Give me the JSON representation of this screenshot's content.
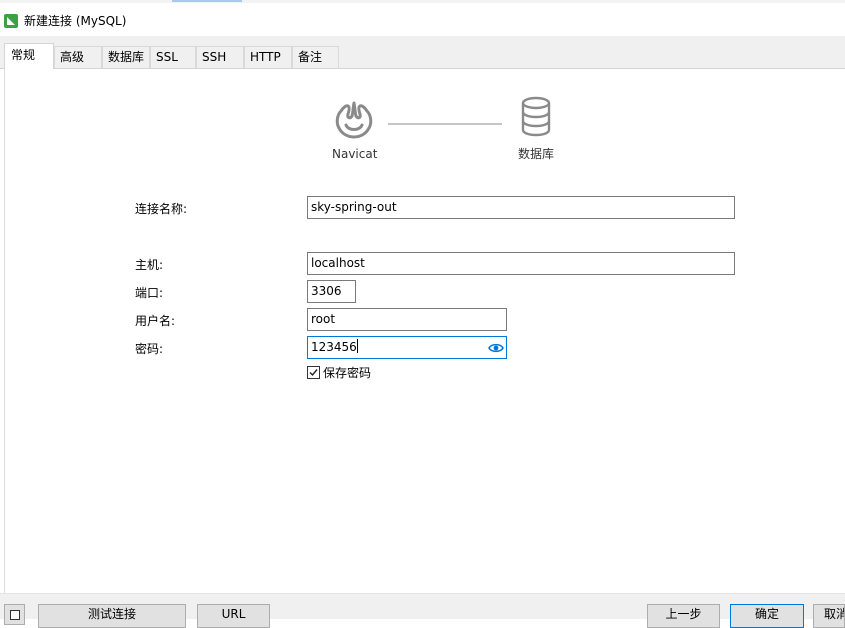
{
  "window": {
    "title": "新建连接 (MySQL)"
  },
  "tabs": [
    {
      "label": "常规",
      "active": true
    },
    {
      "label": "高级"
    },
    {
      "label": "数据库"
    },
    {
      "label": "SSL"
    },
    {
      "label": "SSH"
    },
    {
      "label": "HTTP"
    },
    {
      "label": "备注"
    }
  ],
  "diagram": {
    "left_caption": "Navicat",
    "right_caption": "数据库",
    "left_icon": "navicat-logo-icon",
    "right_icon": "database-icon"
  },
  "form": {
    "connection_name_label": "连接名称:",
    "connection_name_value": "sky-spring-out",
    "host_label": "主机:",
    "host_value": "localhost",
    "port_label": "端口:",
    "port_value": "3306",
    "username_label": "用户名:",
    "username_value": "root",
    "password_label": "密码:",
    "password_value": "123456",
    "save_password_label": "保存密码",
    "save_password_checked": true
  },
  "footer": {
    "test_connection": "测试连接",
    "url": "URL",
    "previous": "上一步",
    "ok": "确定",
    "cancel": "取消"
  },
  "colors": {
    "accent": "#0078d7",
    "app_icon": "#3ca144",
    "icon_gray": "#8a8a8a"
  }
}
